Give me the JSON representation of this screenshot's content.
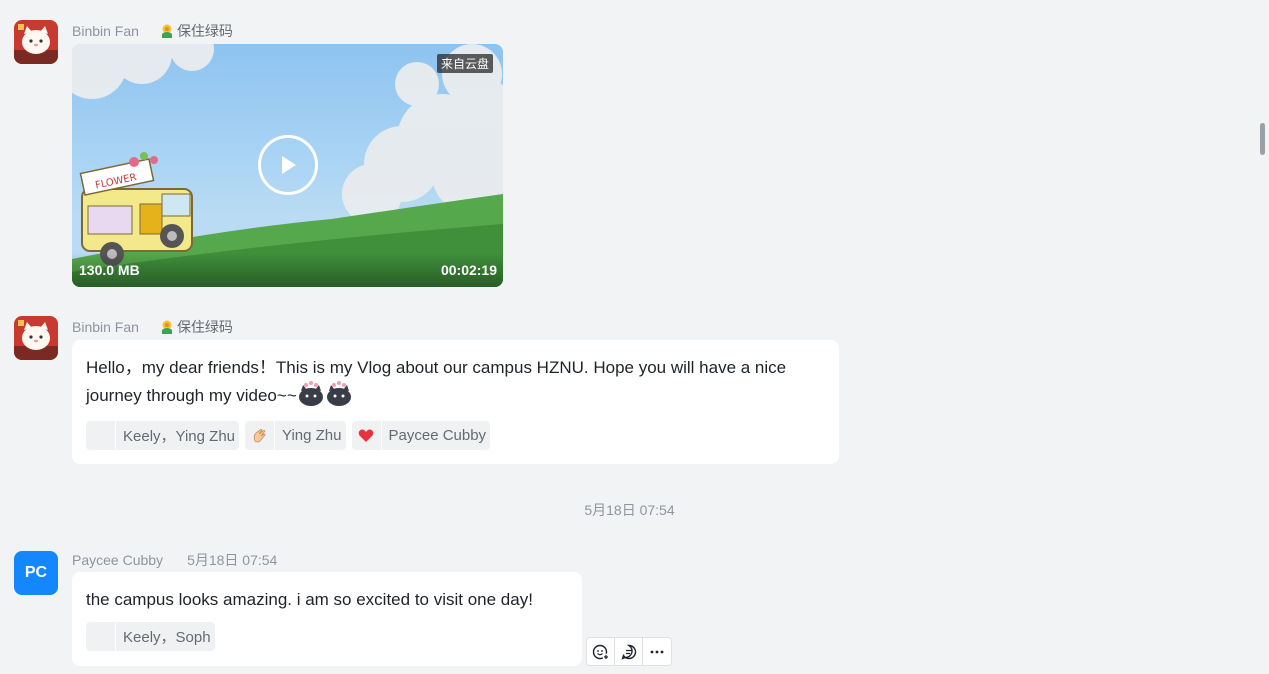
{
  "messages": [
    {
      "sender": "Binbin Fan",
      "status": "保住绿码",
      "video": {
        "source_tag": "来自云盘",
        "size": "130.0 MB",
        "duration": "00:02:19",
        "truck_sign": "FLOWER"
      }
    },
    {
      "sender": "Binbin Fan",
      "status": "保住绿码",
      "text": "Hello，my dear friends！This is my Vlog about our campus HZNU. Hope you will have a nice journey through my video~~",
      "reactions": [
        {
          "emoji": "blank",
          "users": "Keely，Ying Zhu"
        },
        {
          "emoji": "clap-icon",
          "users": "Ying Zhu"
        },
        {
          "emoji": "heart-icon",
          "users": "Paycee Cubby"
        }
      ]
    },
    {
      "sender": "Paycee Cubby",
      "avatar_initials": "PC",
      "time": "5月18日 07:54",
      "text": "the campus looks amazing. i am so excited to visit one day!",
      "reactions": [
        {
          "emoji": "blank",
          "users": "Keely，Soph"
        }
      ]
    }
  ],
  "date_divider": "5月18日 07:54",
  "colors": {
    "background": "#f2f3f5",
    "avatar_pc": "#1487ff",
    "bubble": "#ffffff",
    "heart": "#e8333c"
  },
  "hover_actions": [
    "add-reaction-icon",
    "reply-icon",
    "more-icon"
  ]
}
